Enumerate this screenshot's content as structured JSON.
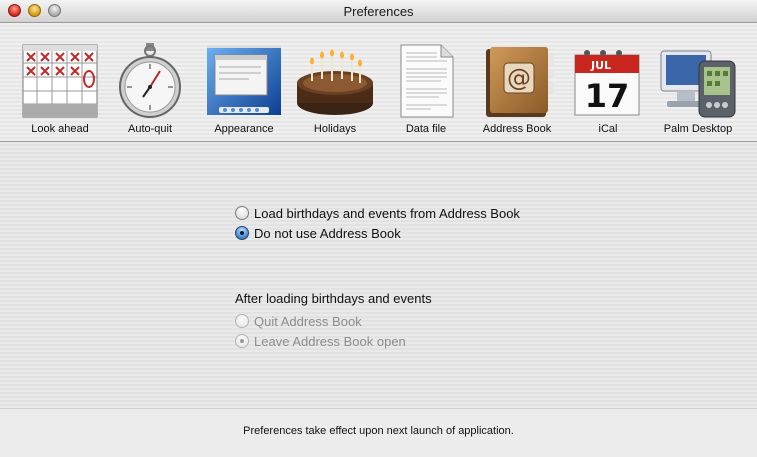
{
  "window": {
    "title": "Preferences"
  },
  "toolbar": {
    "items": [
      {
        "label": "Look ahead",
        "icon": "calendar-grid-icon"
      },
      {
        "label": "Auto-quit",
        "icon": "stopwatch-icon"
      },
      {
        "label": "Appearance",
        "icon": "desktop-screenshot-icon"
      },
      {
        "label": "Holidays",
        "icon": "birthday-cake-icon"
      },
      {
        "label": "Data file",
        "icon": "document-icon"
      },
      {
        "label": "Address Book",
        "icon": "address-book-icon"
      },
      {
        "label": "iCal",
        "icon": "ical-icon",
        "month": "JUL",
        "day": "17"
      },
      {
        "label": "Palm Desktop",
        "icon": "palm-desktop-icon"
      }
    ]
  },
  "options": {
    "source": [
      {
        "label": "Load birthdays and events from Address Book",
        "selected": false,
        "enabled": true
      },
      {
        "label": "Do not use Address Book",
        "selected": true,
        "enabled": true
      }
    ],
    "after_heading": "After loading birthdays and events",
    "after": [
      {
        "label": "Quit Address Book",
        "selected": false,
        "enabled": false
      },
      {
        "label": "Leave Address Book open",
        "selected": true,
        "enabled": false
      }
    ]
  },
  "footer": {
    "note": "Preferences take effect upon next launch of application."
  }
}
